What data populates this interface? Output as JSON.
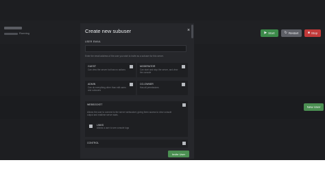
{
  "server": {
    "status": "Running"
  },
  "power_buttons": {
    "start_label": "Start",
    "start_icon": "play-icon",
    "restart_label": "Restart",
    "restart_icon": "refresh-icon",
    "stop_label": "Stop",
    "stop_icon": "stop-icon"
  },
  "users_page": {
    "new_user_label": "New User"
  },
  "modal": {
    "title": "Create new subuser",
    "close_glyph": "×",
    "email_label": "USER EMAIL",
    "email_value": "",
    "email_hint": "Enter the email address of the user you wish to invite as a subuser for this server.",
    "roles": [
      {
        "title": "GUEST",
        "description": "Can view the server but has no actions"
      },
      {
        "title": "MODERATOR",
        "description": "Can start and stop the server, and view the console"
      },
      {
        "title": "ADMIN",
        "description": "Can do everything other than edit users and subusers"
      },
      {
        "title": "CO-OWNER",
        "description": "Has all permissions"
      }
    ],
    "websocket": {
      "title": "WEBSOCKET",
      "description": "Allows the user to connect to the server websocket, giving them access to view console output and realtime server stats.",
      "permission": {
        "title": "LINKS",
        "description": "Allows a user to see console logs"
      }
    },
    "control": {
      "title": "CONTROL"
    },
    "invite_label": "Invite User"
  },
  "colors": {
    "background": "#1d1e21",
    "modal": "#26272b",
    "start": "#3c8a4a",
    "restart": "#5d5f66",
    "stop": "#c23a3a",
    "invite": "#4b8f52"
  }
}
